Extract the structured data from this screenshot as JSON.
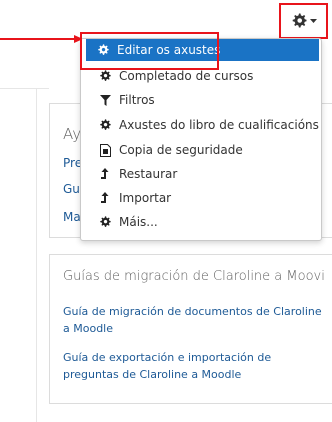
{
  "menu": {
    "items": [
      {
        "label": "Editar os axustes",
        "icon": "gear-icon"
      },
      {
        "label": "Completado de cursos",
        "icon": "gear-icon"
      },
      {
        "label": "Filtros",
        "icon": "filter-icon"
      },
      {
        "label": "Axustes do libro de cualificacións",
        "icon": "gear-icon"
      },
      {
        "label": "Copia de seguridade",
        "icon": "backup-file-icon"
      },
      {
        "label": "Restaurar",
        "icon": "level-up-icon"
      },
      {
        "label": "Importar",
        "icon": "level-up-icon"
      },
      {
        "label": "Máis...",
        "icon": "gear-icon"
      }
    ]
  },
  "block1": {
    "title": "Ayu",
    "links": [
      "Preg",
      "Guía",
      "Man"
    ]
  },
  "block2": {
    "title": "Guías de migración de Claroline a Moovi",
    "links": [
      "Guía de migración de documentos de Claroline a Moodle",
      "Guía de exportación e importación de preguntas de Claroline a Moodle"
    ]
  },
  "colors": {
    "accent": "#1a73c5",
    "annotation": "#e8141b",
    "link": "#1e5a96"
  }
}
